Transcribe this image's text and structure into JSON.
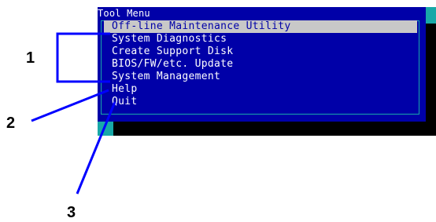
{
  "window": {
    "title": "Tool Menu"
  },
  "menu": {
    "items": [
      {
        "label": "Off-line Maintenance Utility",
        "selected": true
      },
      {
        "label": "System Diagnostics",
        "selected": false
      },
      {
        "label": "Create Support Disk",
        "selected": false
      },
      {
        "label": "BIOS/FW/etc. Update",
        "selected": false
      },
      {
        "label": "System Management",
        "selected": false
      },
      {
        "label": "Help",
        "selected": false
      },
      {
        "label": "Quit",
        "selected": false
      }
    ]
  },
  "callouts": {
    "one": "1",
    "two": "2",
    "three": "3"
  },
  "colors": {
    "menu_background": "#0000a8",
    "screen_background": "#18a8a8",
    "highlight": "#c8c8c8",
    "callout_line": "#0000ff"
  }
}
